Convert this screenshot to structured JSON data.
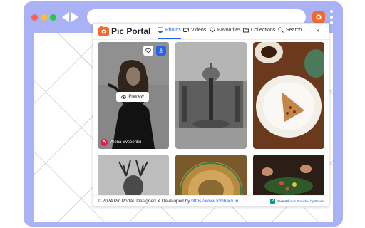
{
  "app": {
    "brand": "Pic Portal"
  },
  "nav": {
    "items": [
      {
        "label": "Photos",
        "icon": "photo-icon",
        "active": true
      },
      {
        "label": "Videos",
        "icon": "video-icon",
        "active": false
      },
      {
        "label": "Favourites",
        "icon": "heart-icon",
        "active": false
      },
      {
        "label": "Collections",
        "icon": "folder-icon",
        "active": false
      },
      {
        "label": "Search",
        "icon": "search-icon",
        "active": false
      }
    ],
    "close_label": "×"
  },
  "gallery": {
    "cards": [
      {
        "subject": "woman-with-curly-hair",
        "hovered": true
      },
      {
        "subject": "cathedral-square-fountain"
      },
      {
        "subject": "pie-slice-and-coffee"
      },
      {
        "subject": "stag-antlers"
      },
      {
        "subject": "wooden-wheel"
      },
      {
        "subject": "hands-with-plants"
      }
    ],
    "preview_label": "Preview",
    "author_initial": "A",
    "author_name": "Alena Evseenko"
  },
  "footer": {
    "text_prefix": "© 2024 Pic Portal. Designed & Developed by ",
    "link": "https://www.tcmhack.in",
    "pexels_logo": "P",
    "pexels_name": "Pexels",
    "pexels_credit": "Photos Provided by Pexels"
  },
  "colors": {
    "browser_frame": "#a8b2f4",
    "accent": "#2563eb",
    "brand_orange": "#f26a2e",
    "avatar": "#e11d48",
    "pexels_green": "#05a081"
  }
}
